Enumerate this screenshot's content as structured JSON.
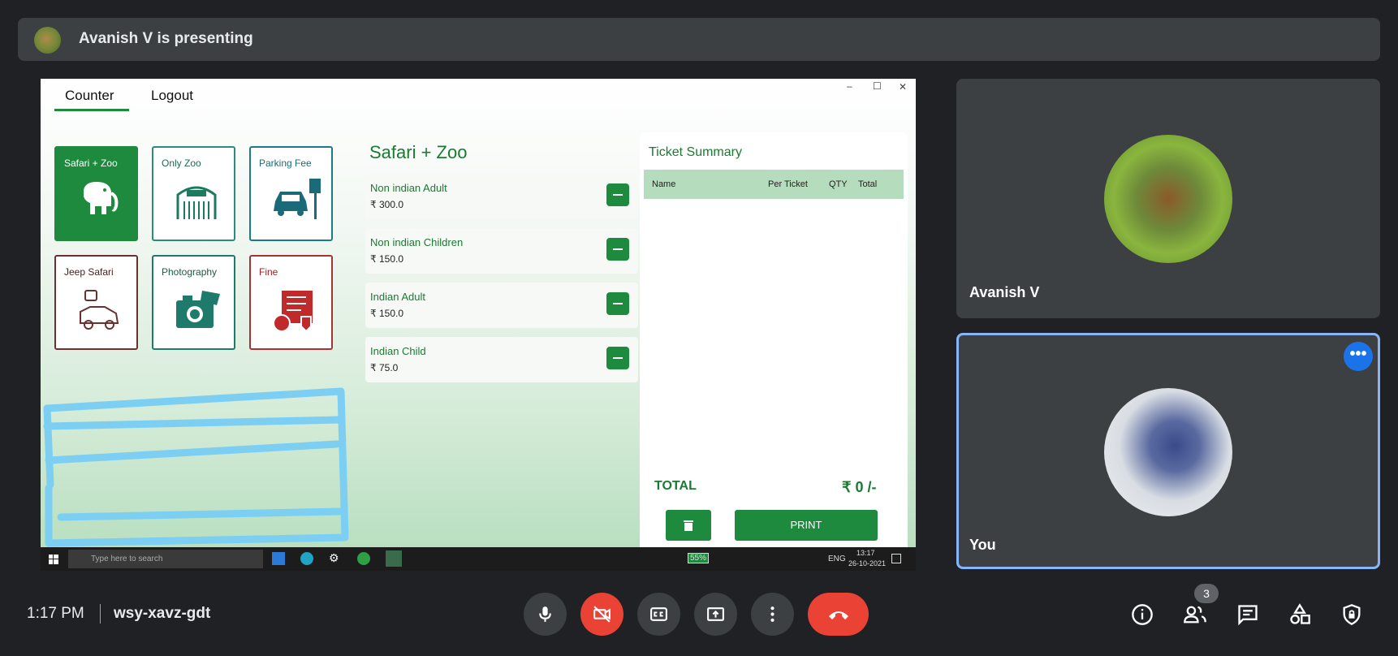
{
  "banner": {
    "presenter_text": "Avanish V is presenting"
  },
  "app": {
    "tabs": {
      "counter": "Counter",
      "logout": "Logout"
    },
    "window_controls": {
      "minimize": "–",
      "maximize": "☐",
      "close": "✕"
    },
    "tiles": [
      {
        "label": "Safari + Zoo",
        "icon": "elephant-icon"
      },
      {
        "label": "Only Zoo",
        "icon": "zoo-gate-icon"
      },
      {
        "label": "Parking Fee",
        "icon": "car-parking-icon"
      },
      {
        "label": "Jeep Safari",
        "icon": "jeep-icon"
      },
      {
        "label": "Photography",
        "icon": "camera-icon"
      },
      {
        "label": "Fine",
        "icon": "bill-icon"
      }
    ],
    "section_title": "Safari + Zoo",
    "tickets": [
      {
        "name": "Non indian Adult",
        "price": "₹ 300.0"
      },
      {
        "name": "Non indian Children",
        "price": "₹ 150.0"
      },
      {
        "name": "Indian Adult",
        "price": "₹ 150.0"
      },
      {
        "name": "Indian Child",
        "price": "₹ 75.0"
      }
    ],
    "summary": {
      "title": "Ticket Summary",
      "columns": {
        "name": "Name",
        "per_ticket": "Per Ticket",
        "qty": "QTY",
        "total": "Total"
      },
      "total_label": "TOTAL",
      "total_value": "₹ 0 /-",
      "print_label": "PRINT"
    },
    "taskbar": {
      "search_placeholder": "Type here to search",
      "battery": "55%",
      "lang": "ENG",
      "time": "13:17",
      "date": "26-10-2021"
    }
  },
  "participants": [
    {
      "name": "Avanish V"
    },
    {
      "name": "You"
    }
  ],
  "bottom": {
    "time": "1:17 PM",
    "meeting_code": "wsy-xavz-gdt",
    "people_count": "3"
  },
  "colors": {
    "accent_green": "#1e8a3e",
    "end_call": "#ea4335",
    "active_border": "#8ab4f8"
  }
}
